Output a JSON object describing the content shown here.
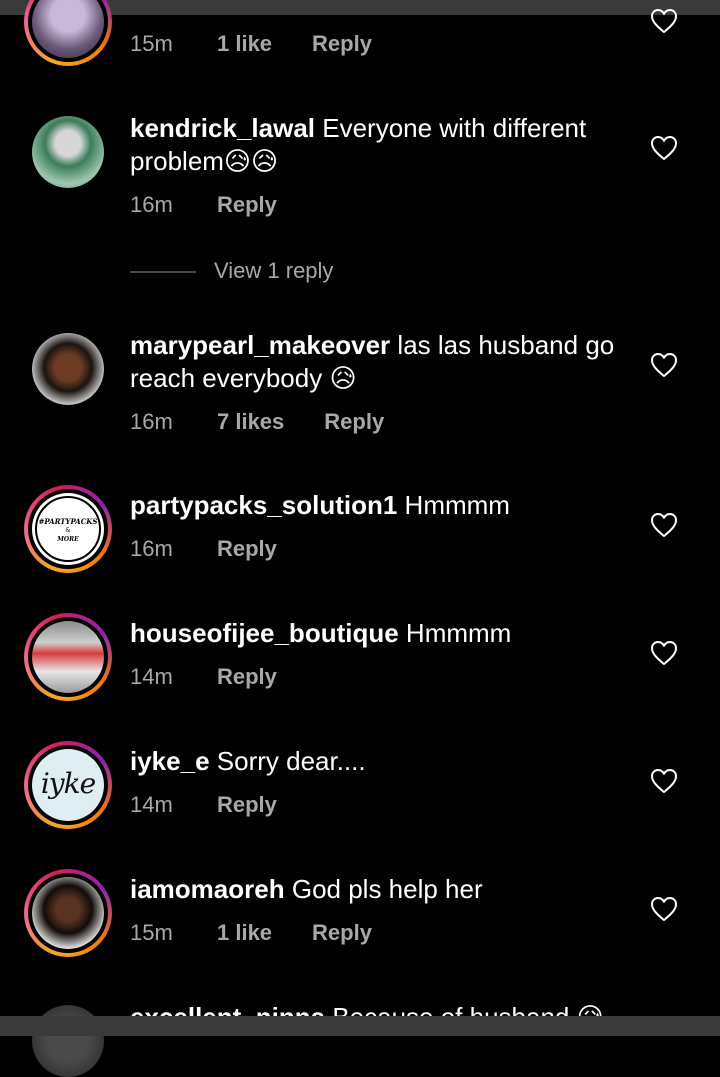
{
  "comments": [
    {
      "username": "",
      "text": "",
      "time": "15m",
      "likes": "1 like",
      "reply": "Reply"
    },
    {
      "username": "kendrick_lawal",
      "text": "Everyone with different problem😥😥",
      "time": "16m",
      "likes": "",
      "reply": "Reply"
    },
    {
      "username": "marypearl_makeover",
      "text": "las las husband go reach everybody 😥",
      "time": "16m",
      "likes": "7 likes",
      "reply": "Reply"
    },
    {
      "username": "partypacks_solution1",
      "text": "Hmmmm",
      "time": "16m",
      "likes": "",
      "reply": "Reply"
    },
    {
      "username": "houseofijee_boutique",
      "text": "Hmmmm",
      "time": "14m",
      "likes": "",
      "reply": "Reply"
    },
    {
      "username": "iyke_e",
      "text": "Sorry dear....",
      "time": "14m",
      "likes": "",
      "reply": "Reply"
    },
    {
      "username": "iamomaoreh",
      "text": "God pls help her",
      "time": "15m",
      "likes": "1 like",
      "reply": "Reply"
    },
    {
      "username": "excellent_ninna",
      "text": "Because of husband 😥",
      "time": "",
      "likes": "",
      "reply": ""
    }
  ],
  "view_replies": "View 1 reply",
  "avatar_text": {
    "partypacks_line1": "#PARTYPACKS",
    "partypacks_line2": "&",
    "partypacks_line3": "MORE",
    "iyke_logo": "iyke"
  },
  "colors": {
    "background": "#000000",
    "secondary_text": "#a8a8a8",
    "story_ring": "#d81b60"
  }
}
